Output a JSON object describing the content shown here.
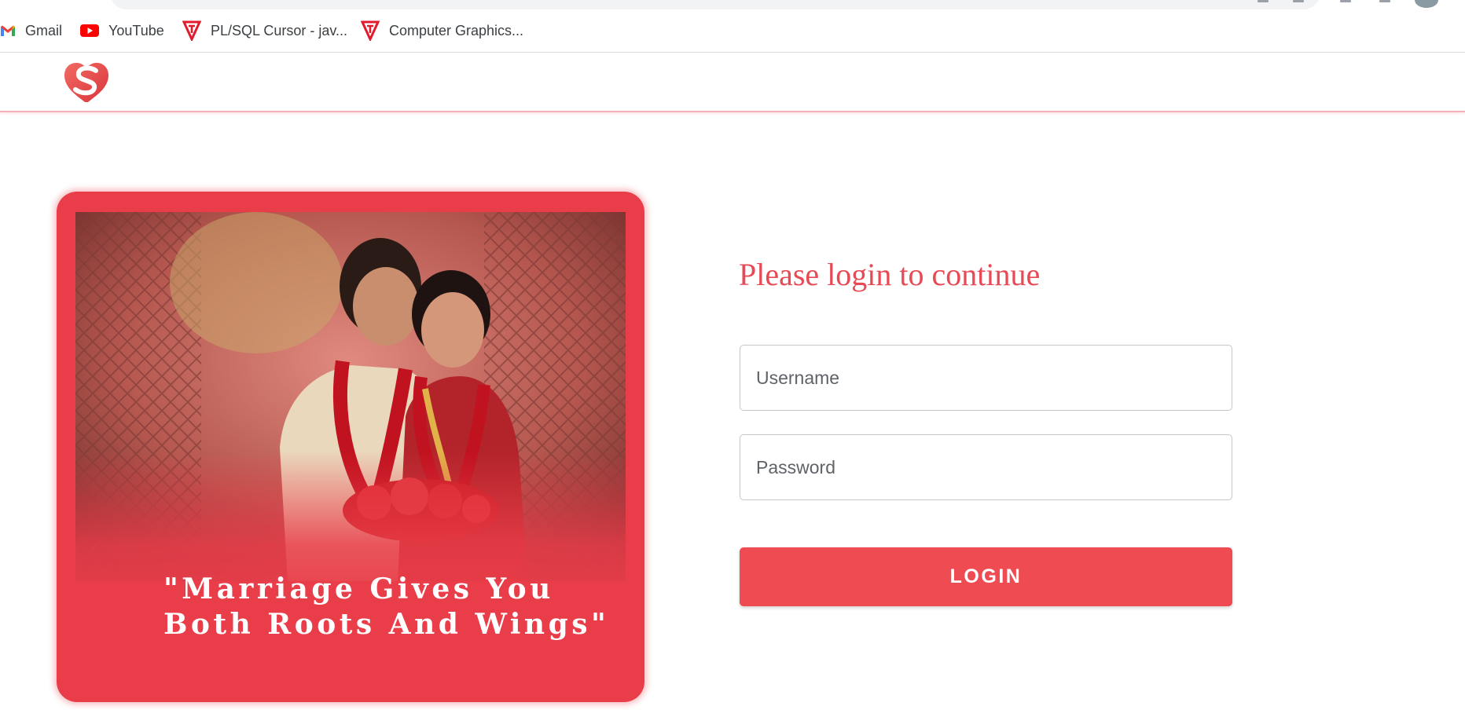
{
  "browser": {
    "bookmarks": [
      {
        "label": "Gmail",
        "icon": "gmail-icon"
      },
      {
        "label": "YouTube",
        "icon": "youtube-icon"
      },
      {
        "label": "PL/SQL Cursor - jav...",
        "icon": "tutorialspoint-icon"
      },
      {
        "label": "Computer Graphics...",
        "icon": "tutorialspoint-icon"
      }
    ]
  },
  "header": {
    "logo_icon": "heart-s-logo-icon",
    "brand_color": "#e84a55"
  },
  "hero": {
    "quote_line1": "\"Marriage Gives You",
    "quote_line2": "Both Roots And Wings\"",
    "background_color": "#e93d49"
  },
  "login": {
    "title": "Please login to continue",
    "username_placeholder": "Username",
    "password_placeholder": "Password",
    "button_label": "LOGIN",
    "button_color": "#ef4b52"
  }
}
